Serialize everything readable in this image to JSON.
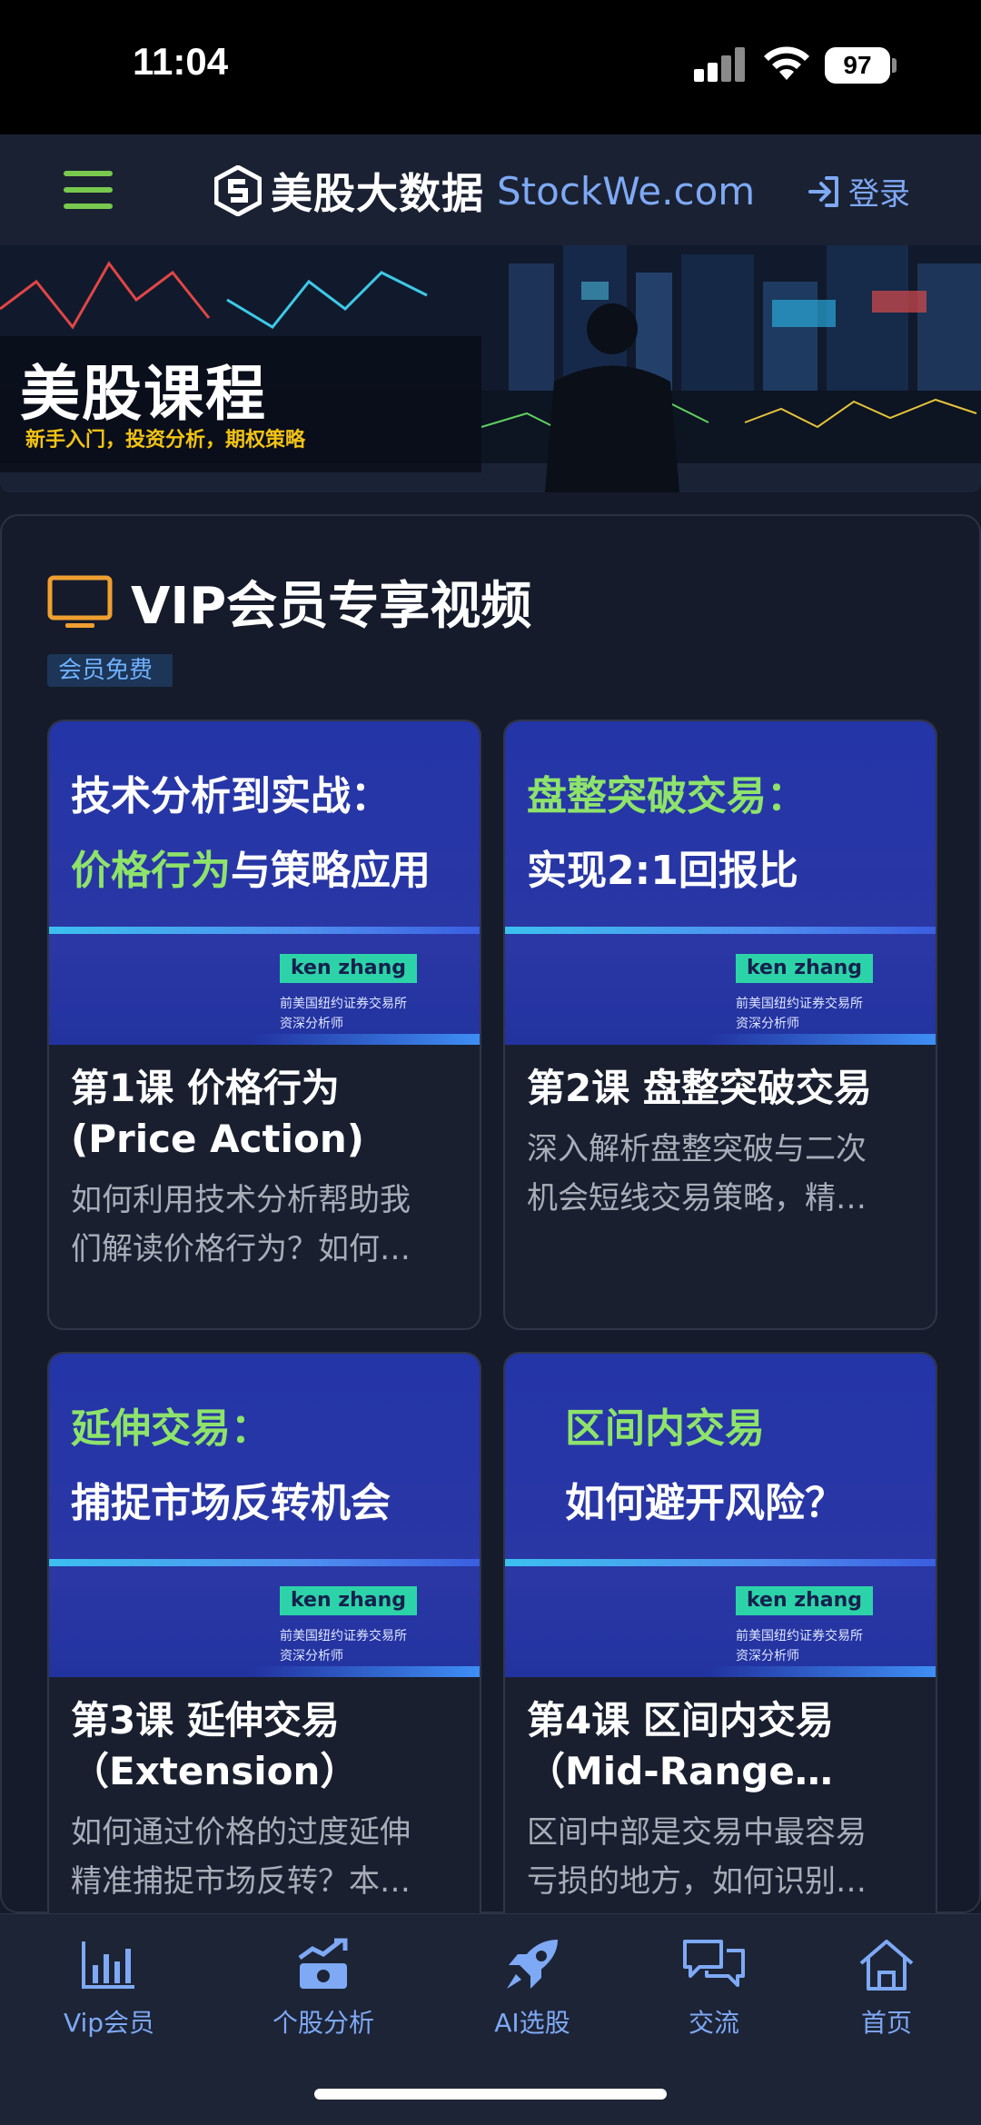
{
  "status_bar": {
    "time": "11:04",
    "battery": "97"
  },
  "header": {
    "brand_name": "美股大数据",
    "brand_domain": "StockWe.com",
    "login_label": "登录",
    "accent_color": "#7ea9f5",
    "menu_color": "#78c94e"
  },
  "banner": {
    "title": "美股课程",
    "subtitle": "新手入门，投资分析，期权策略"
  },
  "section": {
    "title": "VIP会员专享视频",
    "badge": "会员免费"
  },
  "courses": [
    {
      "thumb_line1": "技术分析到实战：",
      "thumb_line2_highlight": "价格行为",
      "thumb_line2_rest": "与策略应用",
      "author": "ken zhang",
      "affiliation_1": "前美国纽约证券交易所",
      "affiliation_2": "资深分析师",
      "title_1": "第1课 价格行为",
      "title_2": "(Price Action)",
      "desc_1": "如何利用技术分析帮助我",
      "desc_2": "们解读价格行为？如何…"
    },
    {
      "thumb_line1_highlight": "盘整突破交易：",
      "thumb_line2": "实现2:1回报比",
      "author": "ken zhang",
      "affiliation_1": "前美国纽约证券交易所",
      "affiliation_2": "资深分析师",
      "title_1": "第2课 盘整突破交易",
      "desc_1": "深入解析盘整突破与二次",
      "desc_2": "机会短线交易策略，精…"
    },
    {
      "thumb_line1_highlight": "延伸交易：",
      "thumb_line2": "捕捉市场反转机会",
      "author": "ken zhang",
      "affiliation_1": "前美国纽约证券交易所",
      "affiliation_2": "资深分析师",
      "title_1": "第3课 延伸交易",
      "title_2": "（Extension）",
      "desc_1": "如何通过价格的过度延伸",
      "desc_2": "精准捕捉市场反转？本…"
    },
    {
      "thumb_line1_highlight": "区间内交易",
      "thumb_line2": "如何避开风险？",
      "author": "ken zhang",
      "affiliation_1": "前美国纽约证券交易所",
      "affiliation_2": "资深分析师",
      "title_1": "第4课 区间内交易",
      "title_2": "（Mid-Range…",
      "desc_1": "区间中部是交易中最容易",
      "desc_2": "亏损的地方，如何识别…"
    }
  ],
  "bottom_nav": {
    "items": [
      {
        "label": "Vip会员",
        "icon": "bar-chart-icon"
      },
      {
        "label": "个股分析",
        "icon": "stock-analysis-icon"
      },
      {
        "label": "AI选股",
        "icon": "rocket-icon"
      },
      {
        "label": "交流",
        "icon": "chat-icon"
      },
      {
        "label": "首页",
        "icon": "home-icon"
      }
    ]
  }
}
